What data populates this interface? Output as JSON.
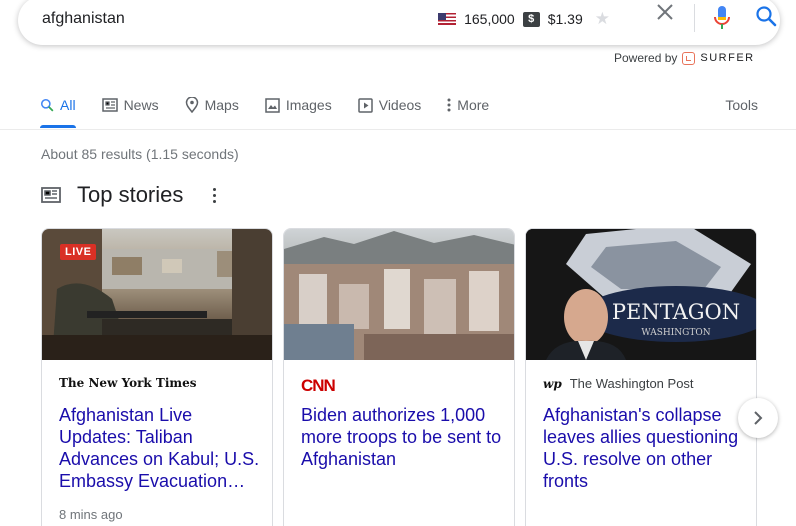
{
  "search": {
    "query": "afghanistan"
  },
  "keyword_stats": {
    "volume": "165,000",
    "cpc": "$1.39",
    "dollar_symbol": "$"
  },
  "powered_by": {
    "label": "Powered by",
    "brand": "SURFER"
  },
  "tabs": [
    {
      "label": "All",
      "icon": "search-icon",
      "active": true
    },
    {
      "label": "News",
      "icon": "news-icon"
    },
    {
      "label": "Maps",
      "icon": "map-pin-icon"
    },
    {
      "label": "Images",
      "icon": "image-icon"
    },
    {
      "label": "Videos",
      "icon": "video-icon"
    },
    {
      "label": "More",
      "icon": "more-vert-icon"
    }
  ],
  "tools_label": "Tools",
  "results_count": "About 85 results (1.15 seconds)",
  "top_stories": {
    "title": "Top stories",
    "cards": [
      {
        "source": "The New York Times",
        "headline": "Afghanistan Live Updates: Taliban Advances on Kabul; U.S. Embassy Evacuation…",
        "time": "8 mins ago",
        "badge": "LIVE"
      },
      {
        "source": "CNN",
        "headline": "Biden authorizes 1,000 more troops to be sent to Afghanistan",
        "time": ""
      },
      {
        "source": "The Washington Post",
        "source_mark": "wp",
        "headline": "Afghanistan's collapse leaves allies questioning U.S. resolve on other fronts",
        "time": "",
        "image_text": {
          "sign": "PENTAGON",
          "subsign": "WASHINGTON"
        }
      }
    ]
  },
  "colors": {
    "link": "#1a0dab",
    "accent": "#1a73e8",
    "live": "#d93025",
    "cnn": "#cc0000"
  }
}
